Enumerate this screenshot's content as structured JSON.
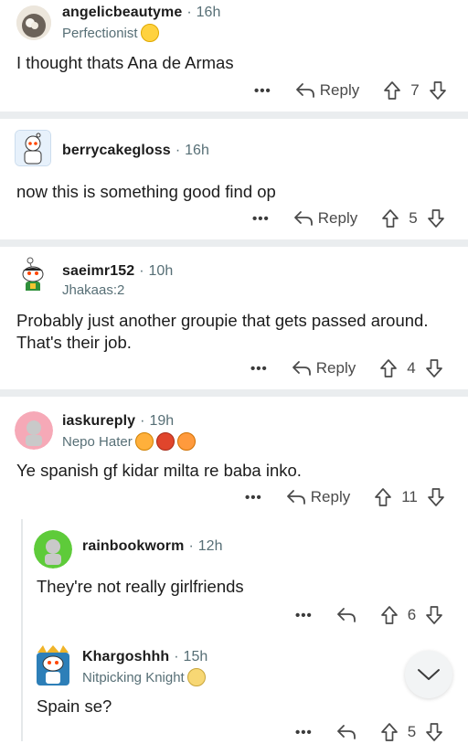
{
  "comments": [
    {
      "username": "angelicbeautyme",
      "age": "16h",
      "flair": "Perfectionist",
      "body": "I thought thats Ana de Armas",
      "reply": "Reply",
      "votes": "7"
    },
    {
      "username": "berrycakegloss",
      "age": "16h",
      "flair": "",
      "body": "now this is something good find op",
      "reply": "Reply",
      "votes": "5"
    },
    {
      "username": "saeimr152",
      "age": "10h",
      "flair": "Jhakaas:2",
      "body": "Probably just another groupie that gets passed around. That's their job.",
      "reply": "Reply",
      "votes": "4"
    },
    {
      "username": "iaskureply",
      "age": "19h",
      "flair": "Nepo Hater",
      "body": "Ye spanish gf kidar milta re baba inko.",
      "reply": "Reply",
      "votes": "11"
    },
    {
      "username": "rainbookworm",
      "age": "12h",
      "flair": "",
      "body": "They're not really girlfriends",
      "votes": "6"
    },
    {
      "username": "Khargoshhh",
      "age": "15h",
      "flair": "Nitpicking Knight",
      "body": "Spain se?",
      "votes": "5"
    }
  ],
  "separator_dot": "·",
  "more_label": "•••",
  "colors": {
    "meta": "#576f76",
    "separator": "#eaedef",
    "text": "#1c1c1c"
  },
  "icons": [
    "reply-arrow-icon",
    "upvote-icon",
    "downvote-icon",
    "overflow-menu-icon",
    "chevron-down-icon"
  ]
}
